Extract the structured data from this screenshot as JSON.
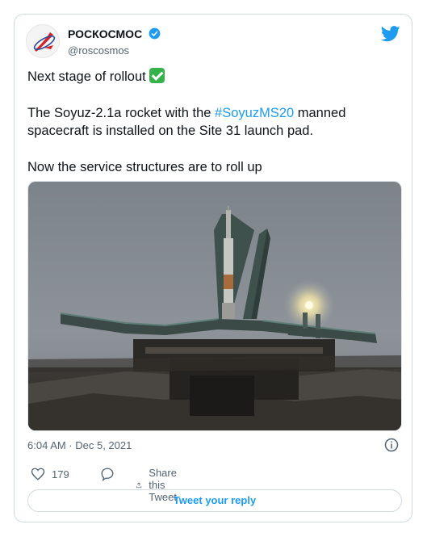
{
  "author": {
    "display_name": "РОСКОСМОС",
    "handle": "@roscosmos",
    "verified": true
  },
  "tweet": {
    "line1_text": "Next stage of rollout",
    "line2_before": "The Soyuz-2.1a rocket with the ",
    "line2_hashtag": "#SoyuzMS20",
    "line2_after": " manned spacecraft is installed on the Site 31 launch pad.",
    "line3_text": "Now the service structures are to roll up",
    "timestamp": "6:04 AM · Dec 5, 2021"
  },
  "stats": {
    "likes": "179",
    "share_label": "Share this Tweet"
  },
  "reply_button": {
    "label": "Tweet your reply"
  },
  "icons": {
    "brand": "twitter-bird-icon",
    "verified": "verified-badge-icon",
    "check": "green-check-emoji",
    "info": "info-icon",
    "like": "heart-icon",
    "reply": "comment-bubble-icon",
    "share": "share-upload-icon"
  },
  "colors": {
    "link": "#1d9bf0",
    "text": "#0f1419",
    "muted": "#536471",
    "border": "#cfd9de",
    "check": "#36b24a"
  }
}
